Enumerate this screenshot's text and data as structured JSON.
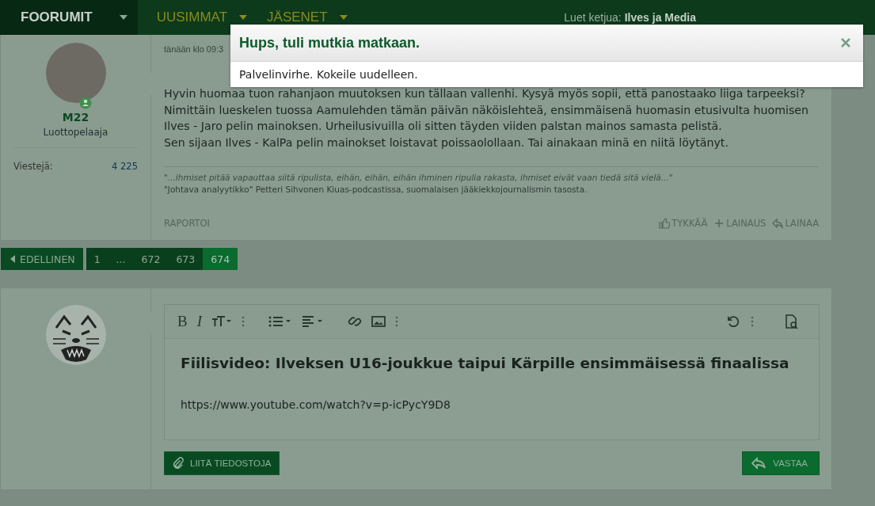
{
  "nav": {
    "items": [
      {
        "label": "FOORUMIT",
        "kind": "home",
        "selected": true
      },
      {
        "label": "UUSIMMAT",
        "kind": "menu",
        "selected": false
      },
      {
        "label": "JÄSENET",
        "kind": "menu",
        "selected": false
      }
    ],
    "thread_prefix": "Luet ketjua:",
    "thread_title": "Ilves ja Media"
  },
  "dialog": {
    "title": "Hups, tuli mutkia matkaan.",
    "message": "Palvelinvirhe. Kokeile uudelleen."
  },
  "post": {
    "author": "M22",
    "role": "Luottopelaaja",
    "online": true,
    "stats": [
      {
        "label": "Viestejä:",
        "value": "4 225"
      }
    ],
    "date": "tänään klo 09:3",
    "body": [
      "Hyvin huomaa tuon rahanjaon muutoksen kun tällaan vallenhi. Kysyä myös sopii, että panostaako liiga tarpeeksi?",
      "Nimittäin lueskelen tuossa Aamulehden tämän päivän näköislehteä, ensimmäisenä huomasin etusivulta huomisen",
      "Ilves - Jaro pelin mainoksen. Urheilusivuilla oli sitten täyden viiden palstan mainos samasta pelistä.",
      "Sen sijaan Ilves - KalPa pelin mainokset loistavat poissaolollaan. Tai ainakaan minä en niitä löytänyt."
    ],
    "signature": {
      "quote": "\"...ihmiset pitää vapauttaa siitä ripulista, eihän, eihän, eihän ihminen ripulia rakasta, ihmiset eivät vaan tiedä sitä vielä...\"",
      "text": "\"Johtava analyytikko\" Petteri Sihvonen Kiuas-podcastissa, suomalaisen jääkiekkojournalismin tasosta."
    },
    "report": "RAPORTOI",
    "actions": [
      {
        "kind": "like",
        "label": "TYKKÄÄ"
      },
      {
        "kind": "multiquote",
        "label": "LAINAUS"
      },
      {
        "kind": "quote",
        "label": "LAINAA"
      }
    ]
  },
  "pagination": {
    "prev": "EDELLINEN",
    "pages": [
      {
        "label": "1",
        "selected": false
      },
      {
        "label": "...",
        "selected": false
      },
      {
        "label": "672",
        "selected": false
      },
      {
        "label": "673",
        "selected": false
      },
      {
        "label": "674",
        "selected": true
      }
    ]
  },
  "editor": {
    "toolbar": [
      {
        "kind": "bold",
        "label": "B"
      },
      {
        "kind": "italic",
        "label": "I"
      },
      {
        "kind": "size"
      },
      {
        "kind": "more"
      },
      {
        "kind": "gap"
      },
      {
        "kind": "list"
      },
      {
        "kind": "align"
      },
      {
        "kind": "gap"
      },
      {
        "kind": "link"
      },
      {
        "kind": "image"
      },
      {
        "kind": "more"
      },
      {
        "kind": "spacer"
      },
      {
        "kind": "undo"
      },
      {
        "kind": "more"
      },
      {
        "kind": "preview"
      }
    ],
    "title": "Fiilisvideo: Ilveksen U16-joukkue taipui Kärpille ensimmäisessä finaalissa",
    "url": "https://www.youtube.com/watch?v=p-icPycY9D8",
    "attach": "LIITÄ TIEDOSTOJA",
    "submit": "VASTAA"
  }
}
